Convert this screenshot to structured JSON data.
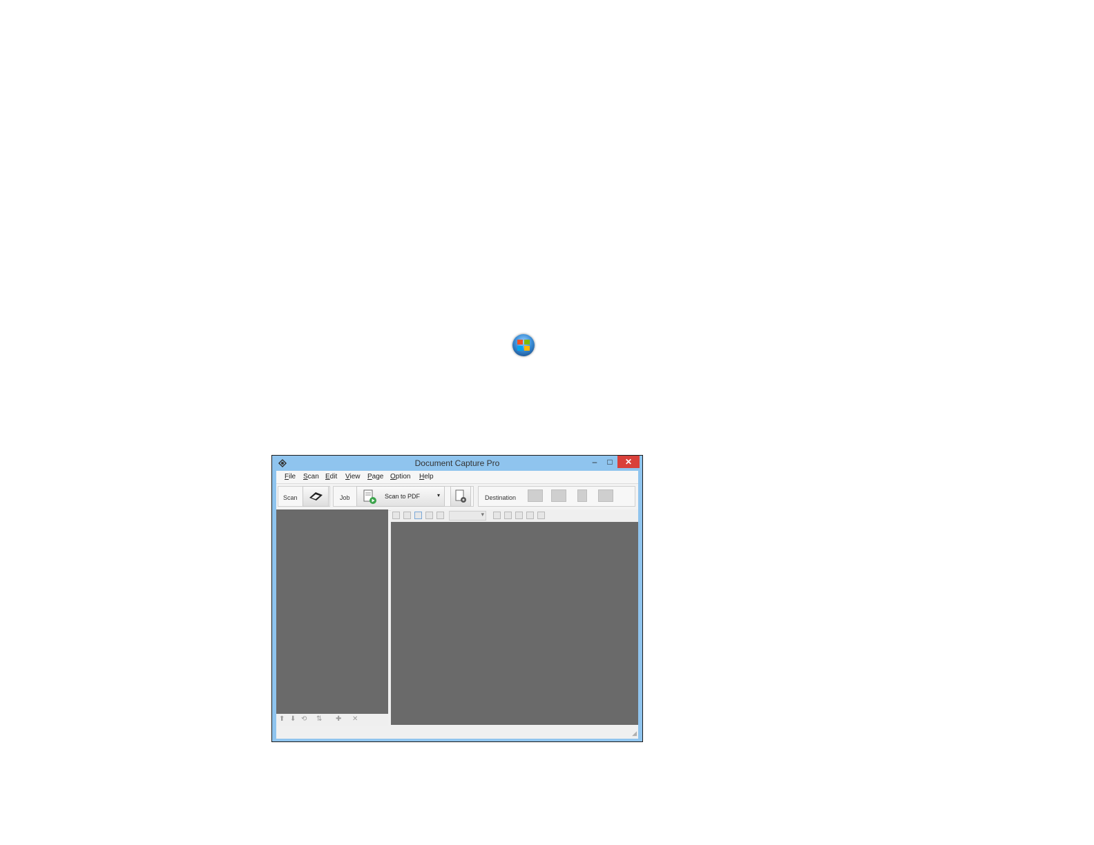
{
  "window": {
    "title": "Document Capture Pro",
    "controls": {
      "minimize": "–",
      "maximize": "□",
      "close": "✕"
    }
  },
  "menu": [
    "File",
    "Scan",
    "Edit",
    "View",
    "Page",
    "Option",
    "Help"
  ],
  "toolbar": {
    "scan_label": "Scan",
    "job_label": "Job",
    "job_selected": "Scan to PDF",
    "destination_label": "Destination"
  },
  "icons": {
    "start": "windows-start-orb-icon",
    "app": "document-capture-pro-icon",
    "scan": "scanner-icon",
    "job": "scan-job-icon",
    "job_settings": "job-settings-icon",
    "destinations": [
      "folder-icon",
      "email-icon",
      "device-icon",
      "printer-icon"
    ]
  },
  "colors": {
    "window_frame": "#8fc4ee",
    "close_button": "#d9403a",
    "pane_background": "#6a6a6a"
  }
}
